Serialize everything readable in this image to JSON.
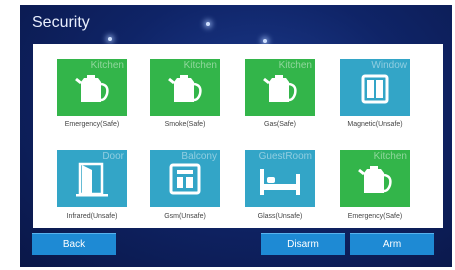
{
  "title": "Security",
  "sensors": [
    {
      "room": "Kitchen",
      "caption": "Emergency(Safe)",
      "status_color": "#33b54a",
      "icon": "kettle-icon"
    },
    {
      "room": "Kitchen",
      "caption": "Smoke(Safe)",
      "status_color": "#33b54a",
      "icon": "kettle-icon"
    },
    {
      "room": "Kitchen",
      "caption": "Gas(Safe)",
      "status_color": "#33b54a",
      "icon": "kettle-icon"
    },
    {
      "room": "Window",
      "caption": "Magnetic(Unsafe)",
      "status_color": "#33a5c7",
      "icon": "window-icon"
    },
    {
      "room": "Door",
      "caption": "Infrared(Unsafe)",
      "status_color": "#33a5c7",
      "icon": "door-icon"
    },
    {
      "room": "Balcony",
      "caption": "Gsm(Unsafe)",
      "status_color": "#33a5c7",
      "icon": "cabinet-icon"
    },
    {
      "room": "GuestRoom",
      "caption": "Glass(Unsafe)",
      "status_color": "#33a5c7",
      "icon": "bed-icon"
    },
    {
      "room": "Kitchen",
      "caption": "Emergency(Safe)",
      "status_color": "#33b54a",
      "icon": "kettle-icon"
    }
  ],
  "buttons": {
    "back": "Back",
    "disarm": "Disarm",
    "arm": "Arm"
  }
}
